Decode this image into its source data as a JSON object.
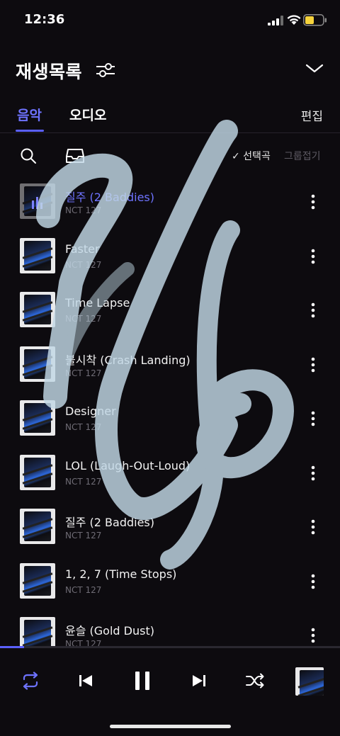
{
  "status_bar": {
    "time": "12:36"
  },
  "header": {
    "title": "재생목록"
  },
  "tabs": {
    "music": "음악",
    "audio": "오디오",
    "edit": "편집"
  },
  "toolbar": {
    "select_songs": "✓ 선택곡",
    "group_fold": "그룹접기"
  },
  "tracks": [
    {
      "title": "질주 (2 Baddies)",
      "artist": "NCT 127",
      "playing": true
    },
    {
      "title": "Faster",
      "artist": "NCT 127"
    },
    {
      "title": "Time Lapse",
      "artist": "NCT 127"
    },
    {
      "title": "불시착 (Crash Landing)",
      "artist": "NCT 127"
    },
    {
      "title": "Designer",
      "artist": "NCT 127"
    },
    {
      "title": "LOL (Laugh-Out-Loud)",
      "artist": "NCT 127"
    },
    {
      "title": "질주 (2 Baddies)",
      "artist": "NCT 127"
    },
    {
      "title": "1, 2, 7 (Time Stops)",
      "artist": "NCT 127"
    },
    {
      "title": "윤슬 (Gold Dust)",
      "artist": "NCT 127"
    }
  ],
  "player": {
    "progress_fraction": 0.07
  },
  "colors": {
    "accent": "#5b60ff",
    "background": "#0d0b0f",
    "muted": "#6f6c75"
  },
  "icons": [
    "signal-icon",
    "wifi-icon",
    "battery-icon",
    "filter-icon",
    "chevron-down-icon",
    "search-icon",
    "inbox-icon",
    "more-icon",
    "equalizer-icon",
    "repeat-icon",
    "previous-icon",
    "pause-icon",
    "next-icon",
    "shuffle-icon"
  ]
}
